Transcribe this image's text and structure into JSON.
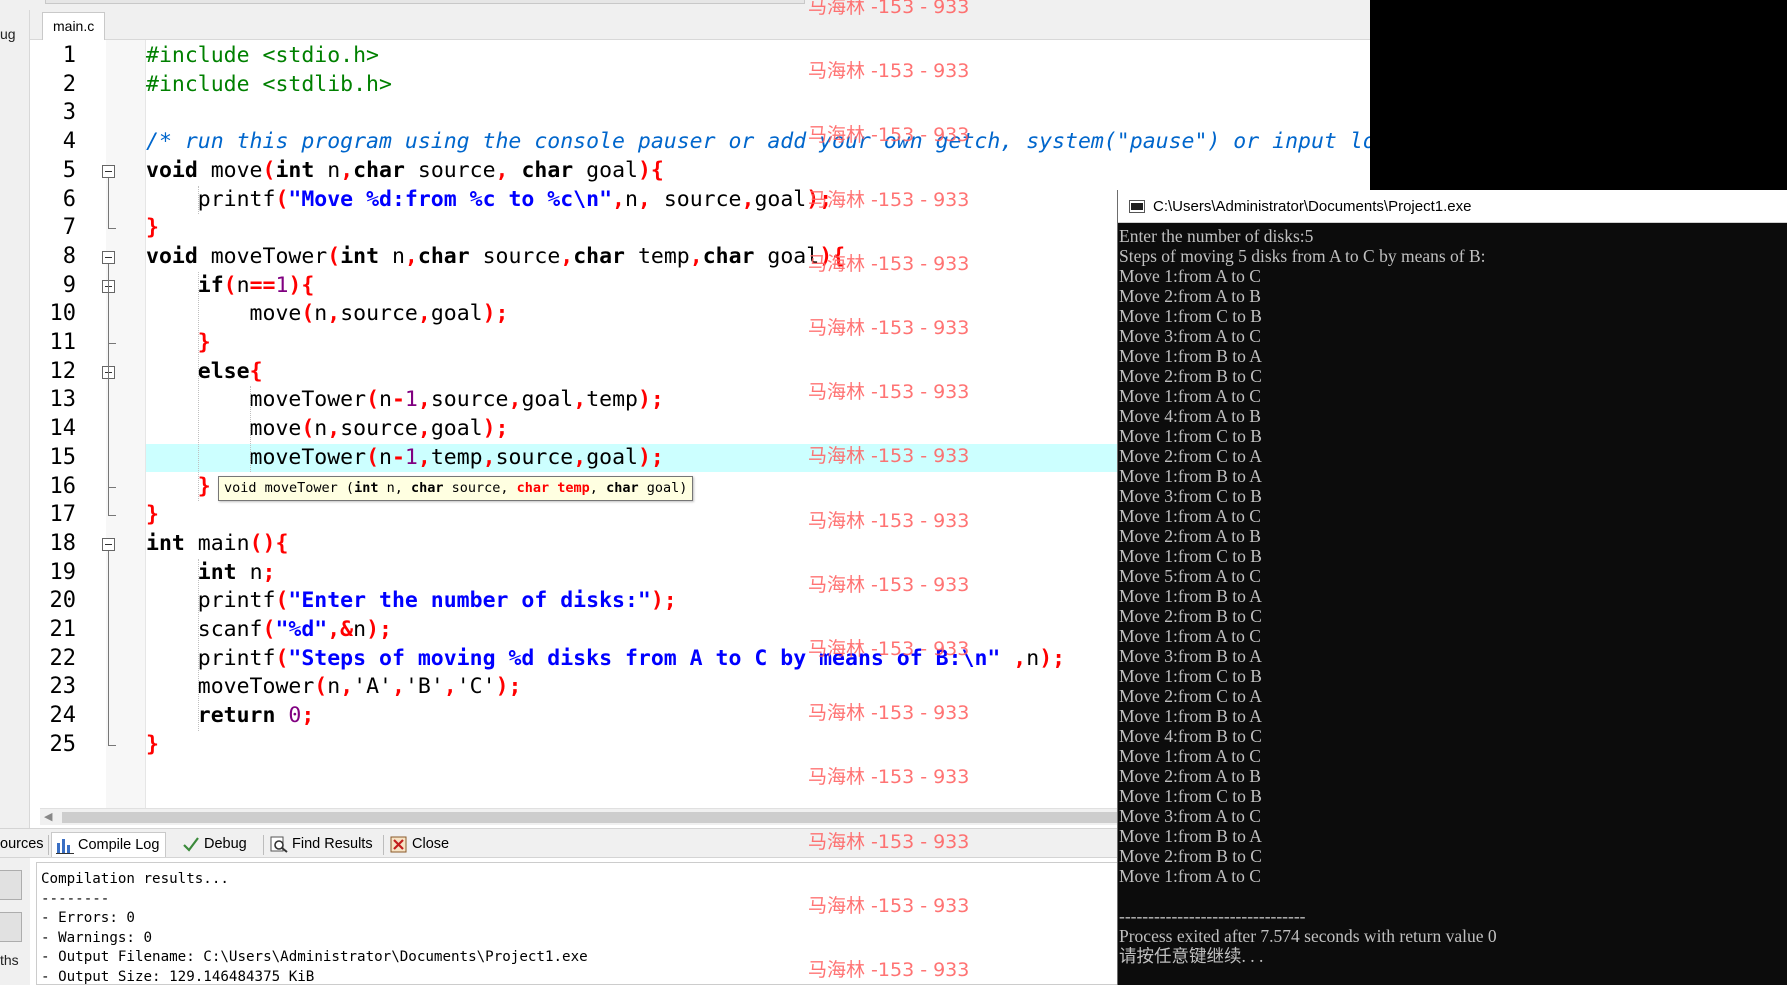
{
  "ide": {
    "left_panel_label": "ug",
    "file_tab": "main.c",
    "line_numbers": [
      "1",
      "2",
      "3",
      "4",
      "5",
      "6",
      "7",
      "8",
      "9",
      "10",
      "11",
      "12",
      "13",
      "14",
      "15",
      "16",
      "17",
      "18",
      "19",
      "20",
      "21",
      "22",
      "23",
      "24",
      "25"
    ],
    "highlighted_line": 15,
    "code_lines": [
      [
        {
          "t": "#include <stdio.h>",
          "c": "pp"
        }
      ],
      [
        {
          "t": "#include <stdlib.h>",
          "c": "pp"
        }
      ],
      [],
      [
        {
          "t": "/* run this program using the console pauser or add your own getch, system(\"pause\") or input loop */",
          "c": "cm"
        }
      ],
      [
        {
          "t": "void",
          "c": "kw"
        },
        {
          "t": " move",
          "c": "ch"
        },
        {
          "t": "(",
          "c": "sym"
        },
        {
          "t": "int",
          "c": "kw"
        },
        {
          "t": " n",
          "c": "ch"
        },
        {
          "t": ",",
          "c": "sym"
        },
        {
          "t": "char",
          "c": "kw"
        },
        {
          "t": " source",
          "c": "ch"
        },
        {
          "t": ",",
          "c": "sym"
        },
        {
          "t": " char",
          "c": "kw"
        },
        {
          "t": " goal",
          "c": "ch"
        },
        {
          "t": "){",
          "c": "sym"
        }
      ],
      [
        {
          "t": "    printf",
          "c": "ch"
        },
        {
          "t": "(",
          "c": "sym"
        },
        {
          "t": "\"Move %d:from %c to %c\\n\"",
          "c": "st"
        },
        {
          "t": ",",
          "c": "sym"
        },
        {
          "t": "n",
          "c": "ch"
        },
        {
          "t": ",",
          "c": "sym"
        },
        {
          "t": " source",
          "c": "ch"
        },
        {
          "t": ",",
          "c": "sym"
        },
        {
          "t": "goal",
          "c": "ch"
        },
        {
          "t": ");",
          "c": "sym"
        }
      ],
      [
        {
          "t": "}",
          "c": "sym"
        }
      ],
      [
        {
          "t": "void",
          "c": "kw"
        },
        {
          "t": " moveTower",
          "c": "ch"
        },
        {
          "t": "(",
          "c": "sym"
        },
        {
          "t": "int",
          "c": "kw"
        },
        {
          "t": " n",
          "c": "ch"
        },
        {
          "t": ",",
          "c": "sym"
        },
        {
          "t": "char",
          "c": "kw"
        },
        {
          "t": " source",
          "c": "ch"
        },
        {
          "t": ",",
          "c": "sym"
        },
        {
          "t": "char",
          "c": "kw"
        },
        {
          "t": " temp",
          "c": "ch"
        },
        {
          "t": ",",
          "c": "sym"
        },
        {
          "t": "char",
          "c": "kw"
        },
        {
          "t": " goal",
          "c": "ch"
        },
        {
          "t": "){",
          "c": "sym"
        }
      ],
      [
        {
          "t": "    ",
          "c": "ch"
        },
        {
          "t": "if",
          "c": "kw"
        },
        {
          "t": "(",
          "c": "sym"
        },
        {
          "t": "n",
          "c": "ch"
        },
        {
          "t": "==",
          "c": "sym"
        },
        {
          "t": "1",
          "c": "num"
        },
        {
          "t": "){",
          "c": "sym"
        }
      ],
      [
        {
          "t": "        move",
          "c": "ch"
        },
        {
          "t": "(",
          "c": "sym"
        },
        {
          "t": "n",
          "c": "ch"
        },
        {
          "t": ",",
          "c": "sym"
        },
        {
          "t": "source",
          "c": "ch"
        },
        {
          "t": ",",
          "c": "sym"
        },
        {
          "t": "goal",
          "c": "ch"
        },
        {
          "t": ");",
          "c": "sym"
        }
      ],
      [
        {
          "t": "    }",
          "c": "sym"
        }
      ],
      [
        {
          "t": "    ",
          "c": "ch"
        },
        {
          "t": "else",
          "c": "kw"
        },
        {
          "t": "{",
          "c": "sym"
        }
      ],
      [
        {
          "t": "        moveTower",
          "c": "ch"
        },
        {
          "t": "(",
          "c": "sym"
        },
        {
          "t": "n",
          "c": "ch"
        },
        {
          "t": "-",
          "c": "sym"
        },
        {
          "t": "1",
          "c": "num"
        },
        {
          "t": ",",
          "c": "sym"
        },
        {
          "t": "source",
          "c": "ch"
        },
        {
          "t": ",",
          "c": "sym"
        },
        {
          "t": "goal",
          "c": "ch"
        },
        {
          "t": ",",
          "c": "sym"
        },
        {
          "t": "temp",
          "c": "ch"
        },
        {
          "t": ");",
          "c": "sym"
        }
      ],
      [
        {
          "t": "        move",
          "c": "ch"
        },
        {
          "t": "(",
          "c": "sym"
        },
        {
          "t": "n",
          "c": "ch"
        },
        {
          "t": ",",
          "c": "sym"
        },
        {
          "t": "source",
          "c": "ch"
        },
        {
          "t": ",",
          "c": "sym"
        },
        {
          "t": "goal",
          "c": "ch"
        },
        {
          "t": ");",
          "c": "sym"
        }
      ],
      [
        {
          "t": "        moveTower",
          "c": "ch"
        },
        {
          "t": "(",
          "c": "sym"
        },
        {
          "t": "n",
          "c": "ch"
        },
        {
          "t": "-",
          "c": "sym"
        },
        {
          "t": "1",
          "c": "num"
        },
        {
          "t": ",",
          "c": "sym"
        },
        {
          "t": "temp",
          "c": "ch"
        },
        {
          "t": ",",
          "c": "sym"
        },
        {
          "t": "source",
          "c": "ch"
        },
        {
          "t": ",",
          "c": "sym"
        },
        {
          "t": "goal",
          "c": "ch"
        },
        {
          "t": ");",
          "c": "sym"
        }
      ],
      [
        {
          "t": "    }",
          "c": "sym"
        }
      ],
      [
        {
          "t": "}",
          "c": "sym"
        }
      ],
      [
        {
          "t": "int",
          "c": "kw"
        },
        {
          "t": " main",
          "c": "ch"
        },
        {
          "t": "(){",
          "c": "sym"
        }
      ],
      [
        {
          "t": "    ",
          "c": "ch"
        },
        {
          "t": "int",
          "c": "kw"
        },
        {
          "t": " n",
          "c": "ch"
        },
        {
          "t": ";",
          "c": "sym"
        }
      ],
      [
        {
          "t": "    printf",
          "c": "ch"
        },
        {
          "t": "(",
          "c": "sym"
        },
        {
          "t": "\"Enter the number of disks:\"",
          "c": "st"
        },
        {
          "t": ");",
          "c": "sym"
        }
      ],
      [
        {
          "t": "    scanf",
          "c": "ch"
        },
        {
          "t": "(",
          "c": "sym"
        },
        {
          "t": "\"%d\"",
          "c": "st"
        },
        {
          "t": ",&",
          "c": "sym"
        },
        {
          "t": "n",
          "c": "ch"
        },
        {
          "t": ");",
          "c": "sym"
        }
      ],
      [
        {
          "t": "    printf",
          "c": "ch"
        },
        {
          "t": "(",
          "c": "sym"
        },
        {
          "t": "\"Steps of moving %d disks from A to C by means of B:\\n\"",
          "c": "st"
        },
        {
          "t": " ,",
          "c": "sym"
        },
        {
          "t": "n",
          "c": "ch"
        },
        {
          "t": ");",
          "c": "sym"
        }
      ],
      [
        {
          "t": "    moveTower",
          "c": "ch"
        },
        {
          "t": "(",
          "c": "sym"
        },
        {
          "t": "n",
          "c": "ch"
        },
        {
          "t": ",",
          "c": "sym"
        },
        {
          "t": "'A'",
          "c": "ch"
        },
        {
          "t": ",",
          "c": "sym"
        },
        {
          "t": "'B'",
          "c": "ch"
        },
        {
          "t": ",",
          "c": "sym"
        },
        {
          "t": "'C'",
          "c": "ch"
        },
        {
          "t": ");",
          "c": "sym"
        }
      ],
      [
        {
          "t": "    ",
          "c": "ch"
        },
        {
          "t": "return",
          "c": "kw"
        },
        {
          "t": " ",
          "c": "ch"
        },
        {
          "t": "0",
          "c": "num"
        },
        {
          "t": ";",
          "c": "sym"
        }
      ],
      [
        {
          "t": "}",
          "c": "sym"
        }
      ]
    ],
    "tooltip": [
      {
        "t": "void",
        "c": ""
      },
      {
        "t": " moveTower (",
        "c": ""
      },
      {
        "t": "int",
        "c": "tb"
      },
      {
        "t": " n, ",
        "c": ""
      },
      {
        "t": "char",
        "c": "tb"
      },
      {
        "t": " source, ",
        "c": ""
      },
      {
        "t": "char temp",
        "c": "hi"
      },
      {
        "t": ", ",
        "c": ""
      },
      {
        "t": "char",
        "c": "tb"
      },
      {
        "t": " goal)",
        "c": ""
      }
    ],
    "bottom_tabs": {
      "sources": "ources",
      "compile_log": "Compile Log",
      "debug": "Debug",
      "find_results": "Find Results",
      "close": "Close"
    },
    "log_left_label": "ths",
    "compile_log": [
      "Compilation results...",
      "--------",
      "- Errors: 0",
      "- Warnings: 0",
      "- Output Filename: C:\\Users\\Administrator\\Documents\\Project1.exe",
      "- Output Size: 129.146484375 KiB"
    ]
  },
  "console": {
    "title": "C:\\Users\\Administrator\\Documents\\Project1.exe",
    "lines": [
      "Enter the number of disks:5",
      "Steps of moving 5 disks from A to C by means of B:",
      "Move 1:from A to C",
      "Move 2:from A to B",
      "Move 1:from C to B",
      "Move 3:from A to C",
      "Move 1:from B to A",
      "Move 2:from B to C",
      "Move 1:from A to C",
      "Move 4:from A to B",
      "Move 1:from C to B",
      "Move 2:from C to A",
      "Move 1:from B to A",
      "Move 3:from C to B",
      "Move 1:from A to C",
      "Move 2:from A to B",
      "Move 1:from C to B",
      "Move 5:from A to C",
      "Move 1:from B to A",
      "Move 2:from B to C",
      "Move 1:from A to C",
      "Move 3:from B to A",
      "Move 1:from C to B",
      "Move 2:from C to A",
      "Move 1:from B to A",
      "Move 4:from B to C",
      "Move 1:from A to C",
      "Move 2:from A to B",
      "Move 1:from C to B",
      "Move 3:from A to C",
      "Move 1:from B to A",
      "Move 2:from B to C",
      "Move 1:from A to C",
      "",
      "--------------------------------",
      "Process exited after 7.574 seconds with return value 0",
      "请按任意键继续. . ."
    ]
  },
  "watermark": {
    "text": "马海林 -153 - 933",
    "color": "#ff6464",
    "count": 16
  }
}
